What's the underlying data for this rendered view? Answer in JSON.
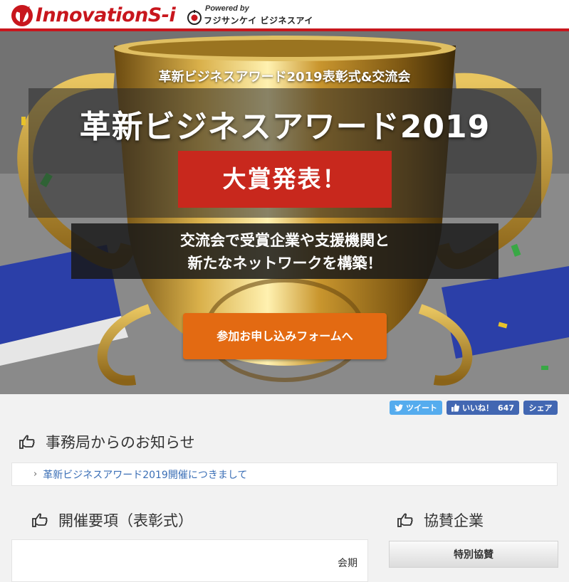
{
  "header": {
    "logo_text": "InnovationS-i",
    "powered_by": "Powered by",
    "partner_name": "フジサンケイ ビジネスアイ"
  },
  "hero": {
    "subtitle": "革新ビジネスアワード2019表彰式&交流会",
    "title": "革新ビジネスアワード2019",
    "badge": "大賞発表！",
    "message_line1": "交流会で受賞企業や支援機関と",
    "message_line2": "新たなネットワークを構築！",
    "cta_label": "参加お申し込みフォームへ"
  },
  "social": {
    "tweet_label": "ツイート",
    "like_label": "いいね！",
    "like_count": "647",
    "share_label": "シェア"
  },
  "notice": {
    "heading": "事務局からのお知らせ",
    "items": [
      {
        "label": "革新ビジネスアワード2019開催につきまして"
      }
    ]
  },
  "overview": {
    "heading": "開催要項（表彰式）",
    "venue_label": "会期"
  },
  "sponsors": {
    "heading": "協賛企業",
    "tab_label": "特別協賛"
  },
  "colors": {
    "brand_red": "#c8161d",
    "cta_orange": "#e36a12",
    "badge_red": "#c8281d",
    "link_blue": "#3b6fb6",
    "twitter_blue": "#55acee",
    "facebook_blue": "#4267b2"
  }
}
